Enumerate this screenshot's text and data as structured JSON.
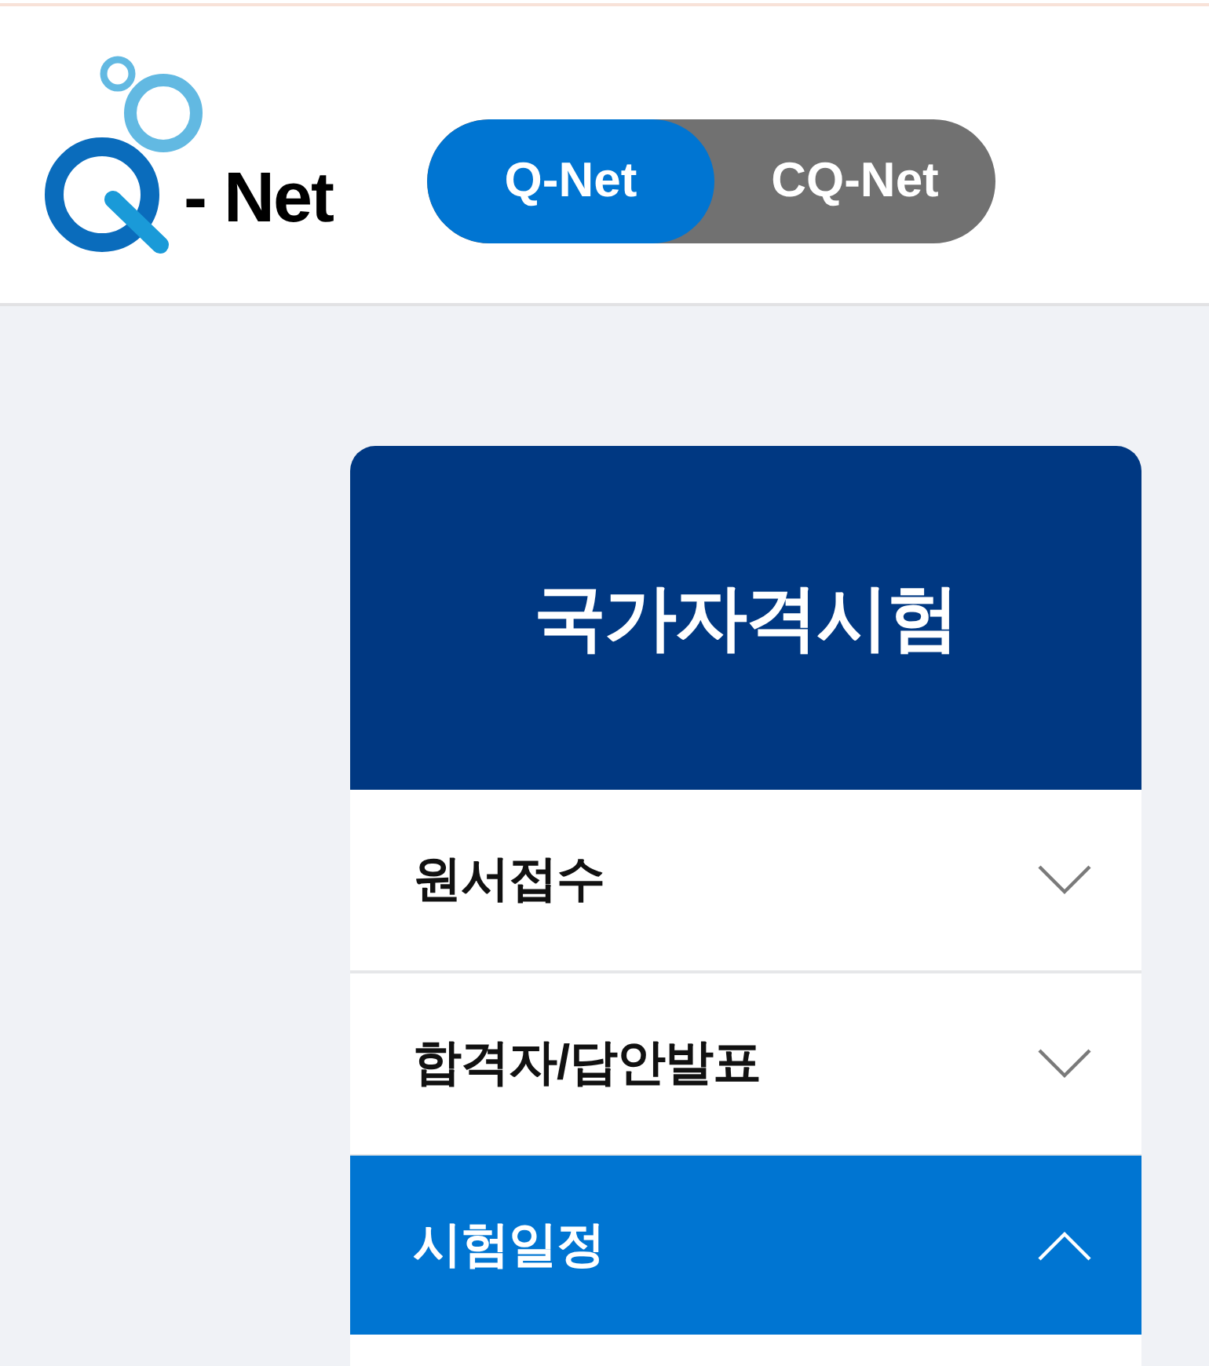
{
  "header": {
    "logo": {
      "text": "- Net"
    },
    "site_switch": [
      {
        "label": "Q-Net",
        "selected": true
      },
      {
        "label": "CQ-Net",
        "selected": false
      }
    ]
  },
  "side_menu": {
    "title": "국가자격시험",
    "items": [
      {
        "label": "원서접수",
        "expanded": false
      },
      {
        "label": "합격자/답안발표",
        "expanded": false
      },
      {
        "label": "시험일정",
        "expanded": true
      }
    ]
  }
}
